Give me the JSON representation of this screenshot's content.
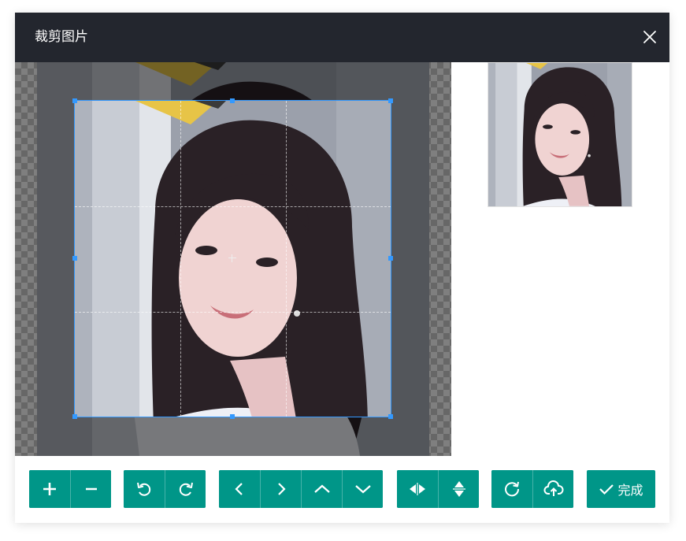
{
  "dialog": {
    "title": "裁剪图片",
    "close_icon": "close-icon"
  },
  "colors": {
    "header_bg": "#23262e",
    "button_bg": "#009688",
    "crop_outline": "#3399ff"
  },
  "toolbar": {
    "groups": [
      [
        {
          "name": "zoom-in",
          "icon": "plus-icon"
        },
        {
          "name": "zoom-out",
          "icon": "minus-icon"
        }
      ],
      [
        {
          "name": "rotate-left",
          "icon": "rotate-ccw-icon"
        },
        {
          "name": "rotate-right",
          "icon": "rotate-cw-icon"
        }
      ],
      [
        {
          "name": "move-left",
          "icon": "chevron-left-icon"
        },
        {
          "name": "move-right",
          "icon": "chevron-right-icon"
        },
        {
          "name": "move-up",
          "icon": "chevron-up-icon"
        },
        {
          "name": "move-down",
          "icon": "chevron-down-icon"
        }
      ],
      [
        {
          "name": "flip-horizontal",
          "icon": "flip-horizontal-icon"
        },
        {
          "name": "flip-vertical",
          "icon": "flip-vertical-icon"
        }
      ],
      [
        {
          "name": "reset",
          "icon": "refresh-icon"
        },
        {
          "name": "upload",
          "icon": "cloud-upload-icon"
        }
      ]
    ],
    "done_label": "完成",
    "done_icon": "check-icon"
  }
}
